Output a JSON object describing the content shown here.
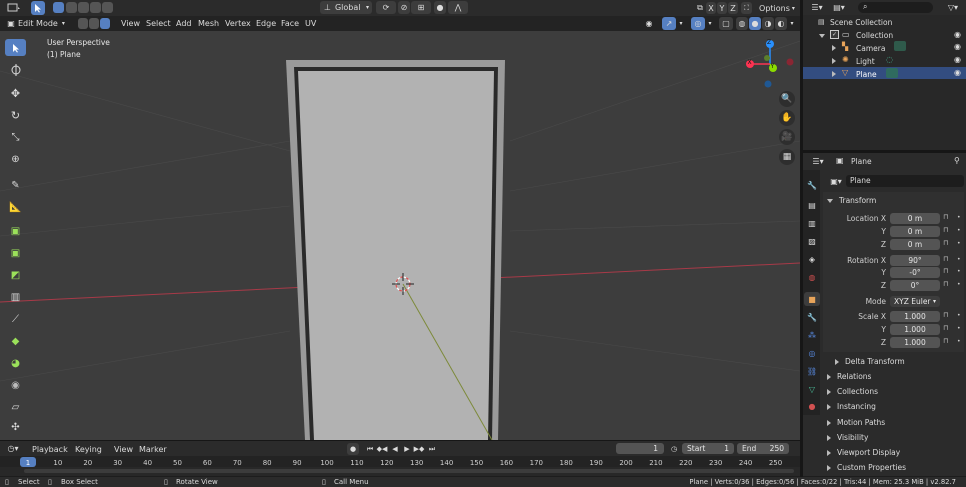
{
  "header": {
    "mode": "Edit Mode",
    "menus": [
      "View",
      "Select",
      "Add",
      "Mesh",
      "Vertex",
      "Edge",
      "Face",
      "UV"
    ],
    "orientation": "Global",
    "xyz": [
      "X",
      "Y",
      "Z"
    ],
    "options": "Options"
  },
  "viewport": {
    "perspective": "User Perspective",
    "object_label": "(1) Plane",
    "gizmo": {
      "x": "X",
      "y": "Y",
      "z": "Z"
    }
  },
  "outliner": {
    "scene_collection": "Scene Collection",
    "items": [
      {
        "label": "Collection"
      },
      {
        "label": "Camera"
      },
      {
        "label": "Light"
      },
      {
        "label": "Plane"
      }
    ]
  },
  "properties": {
    "header_object": "Plane",
    "object_name": "Plane",
    "transform_title": "Transform",
    "location": {
      "label_x": "Location X",
      "label_y": "Y",
      "label_z": "Z",
      "x": "0 m",
      "y": "0 m",
      "z": "0 m"
    },
    "rotation": {
      "label_x": "Rotation X",
      "label_y": "Y",
      "label_z": "Z",
      "x": "90°",
      "y": "-0°",
      "z": "0°"
    },
    "mode_label": "Mode",
    "mode_value": "XYZ Euler",
    "scale": {
      "label_x": "Scale X",
      "label_y": "Y",
      "label_z": "Z",
      "x": "1.000",
      "y": "1.000",
      "z": "1.000"
    },
    "delta_transform": "Delta Transform",
    "sections": [
      "Relations",
      "Collections",
      "Instancing",
      "Motion Paths",
      "Visibility",
      "Viewport Display",
      "Custom Properties"
    ]
  },
  "timeline": {
    "menus": [
      "Playback",
      "Keying",
      "View",
      "Marker"
    ],
    "current_frame": "1",
    "start_label": "Start",
    "start_value": "1",
    "end_label": "End",
    "end_value": "250",
    "ticks": [
      "1",
      "10",
      "20",
      "30",
      "40",
      "50",
      "60",
      "70",
      "80",
      "90",
      "100",
      "110",
      "120",
      "130",
      "140",
      "150",
      "160",
      "170",
      "180",
      "190",
      "200",
      "210",
      "220",
      "230",
      "240",
      "250"
    ]
  },
  "statusbar": {
    "select": "Select",
    "box_select": "Box Select",
    "rotate_view": "Rotate View",
    "call_menu": "Call Menu",
    "stats": "Plane | Verts:0/36 | Edges:0/56 | Faces:0/22 | Tris:44 | Mem: 25.3 MiB | v2.82.7"
  },
  "colors": {
    "accent": "#5680c2",
    "axis_x": "#ff3352",
    "axis_y": "#8bdc00",
    "axis_z": "#2890ff"
  }
}
